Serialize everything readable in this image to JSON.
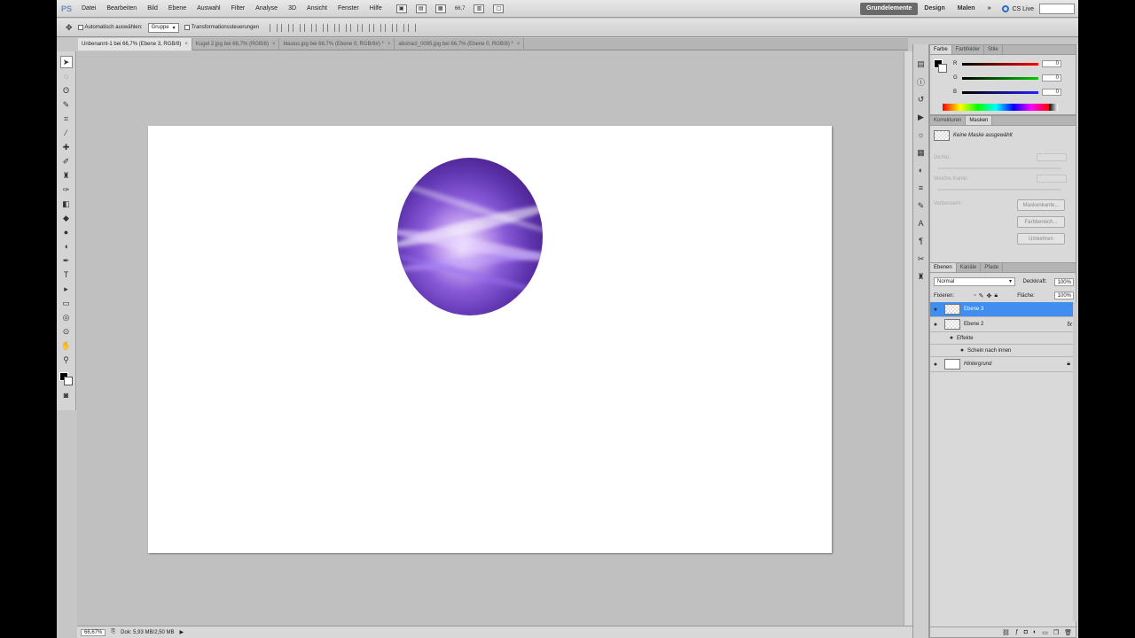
{
  "menu": {
    "logo": "PS",
    "items": [
      "Datei",
      "Bearbeiten",
      "Bild",
      "Ebene",
      "Auswahl",
      "Filter",
      "Analyse",
      "3D",
      "Ansicht",
      "Fenster",
      "Hilfe"
    ],
    "zoom": "66,7"
  },
  "workspaces": {
    "items": [
      "Grundelemente",
      "Design",
      "Malen"
    ],
    "more": "»",
    "cslive": "CS Live"
  },
  "options": {
    "auto_select_label": "Automatisch auswählen:",
    "auto_select_value": "Gruppe",
    "transform_label": "Transformationsst­euerungen"
  },
  "tabs": [
    {
      "label": "Unbenannt-1 bei 66,7% (Ebene 3, RGB/8)",
      "close": "×"
    },
    {
      "label": "Kugel 2.jpg bei 66,7% (RGB/8)",
      "close": "×"
    },
    {
      "label": "blasius.jpg bei 66,7% (Ebene 0, RGB/8#) *",
      "close": "×"
    },
    {
      "label": "abstract_0095.jpg bei 66,7% (Ebene 0, RGB/8) *",
      "close": "×"
    }
  ],
  "status": {
    "zoom": "66,67%",
    "doc": "Dok: 5,93 MB/2,50 MB"
  },
  "color_panel": {
    "tabs": [
      "Farbe",
      "Farbfelder",
      "Stile"
    ],
    "channels": [
      {
        "label": "R",
        "value": "0",
        "color": "#d22"
      },
      {
        "label": "G",
        "value": "0",
        "color": "#2a2"
      },
      {
        "label": "B",
        "value": "0",
        "color": "#22c"
      }
    ]
  },
  "mask_panel": {
    "tabs": [
      "Korrekturen",
      "Masken"
    ],
    "no_mask": "Keine Maske ausgewählt",
    "density": "Dichte:",
    "feather": "Weiche Kante:",
    "refine": "Verbessern:",
    "btn_edge": "Maskenkante...",
    "btn_color": "Farbbereich...",
    "btn_invert": "Umkehren"
  },
  "layers_panel": {
    "tabs": [
      "Ebenen",
      "Kanäle",
      "Pfade"
    ],
    "blend_mode": "Normal",
    "opacity_label": "Deckkraft:",
    "opacity": "100%",
    "lock_label": "Fixieren:",
    "fill_label": "Fläche:",
    "fill": "100%",
    "layers": [
      {
        "name": "Ebene 3"
      },
      {
        "name": "Ebene 2",
        "fx": "fx"
      },
      {
        "name": "Effekte"
      },
      {
        "name": "Schein nach innen"
      },
      {
        "name": "Hintergrund"
      }
    ]
  }
}
